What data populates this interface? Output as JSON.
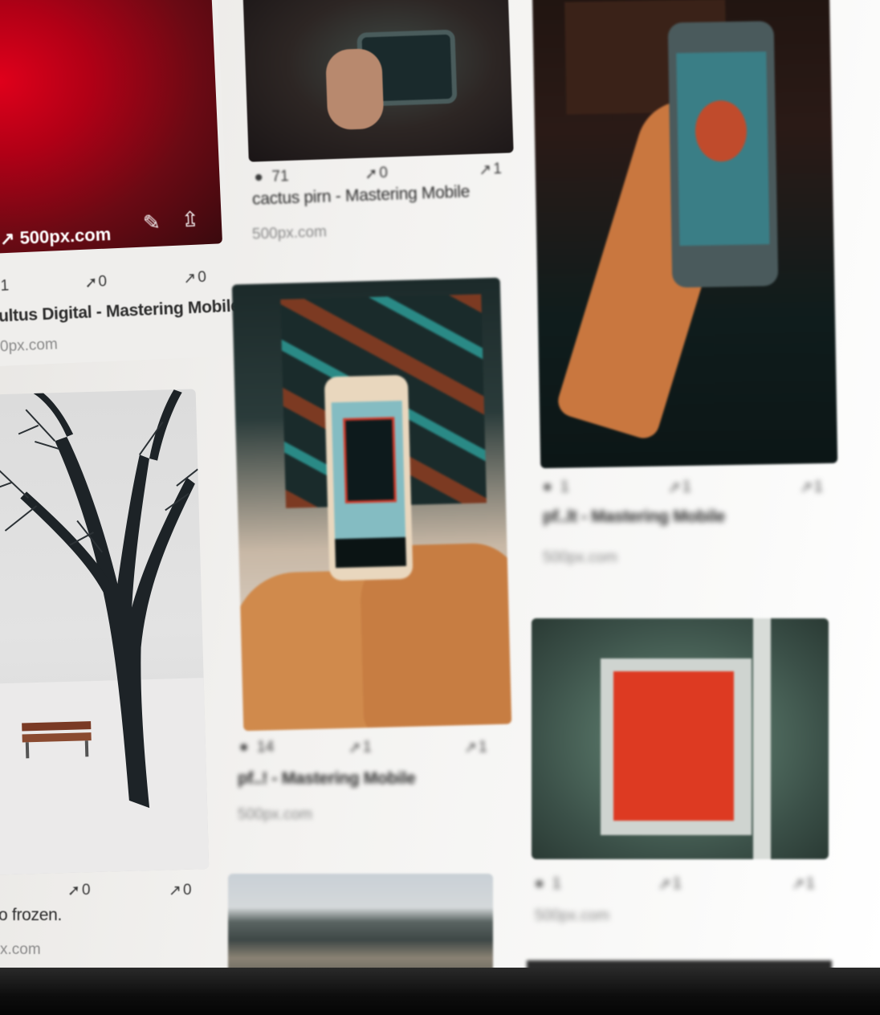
{
  "col1": {
    "card1": {
      "link": "500px.com",
      "views": "1",
      "pins": "0",
      "shares": "0",
      "title": "ultus Digital - Mastering Mobile",
      "source": "0px.com"
    },
    "card2": {
      "pins": "0",
      "shares": "0",
      "title": "o frozen.",
      "source": "x.com"
    }
  },
  "col2": {
    "card1": {
      "views": "71",
      "pins": "0",
      "shares": "1",
      "title": "cactus pirn - Mastering Mobile",
      "source": "500px.com"
    },
    "card2": {
      "views": "14",
      "pins": "1",
      "shares": "1",
      "title": "pf..! - Mastering Mobile",
      "source": "500px.com"
    }
  },
  "col3": {
    "card1": {
      "views": "1",
      "pins": "1",
      "shares": "1",
      "title": "pf..lt - Mastering Mobile",
      "source": "500px.com"
    },
    "card2": {
      "views": "1",
      "pins": "1",
      "shares": "1",
      "source": "500px.com"
    }
  }
}
